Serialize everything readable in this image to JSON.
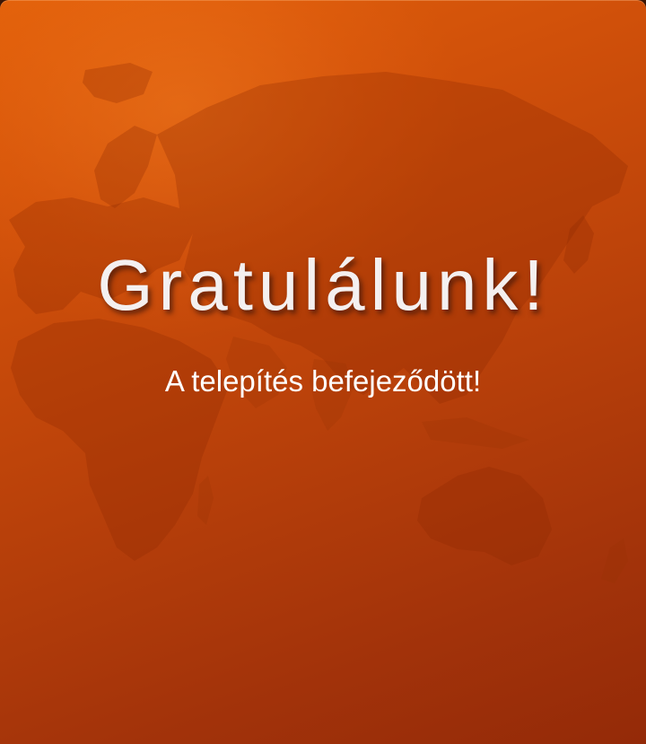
{
  "dialog": {
    "title": "Gratulálunk!",
    "message": "A telepítés befejeződött!"
  },
  "colors": {
    "background_top": "#e1600a",
    "background_bottom": "#942a08",
    "title_text": "#f4f0f0",
    "message_text": "#ffffff"
  },
  "decoration": {
    "background_image": "world-map"
  }
}
